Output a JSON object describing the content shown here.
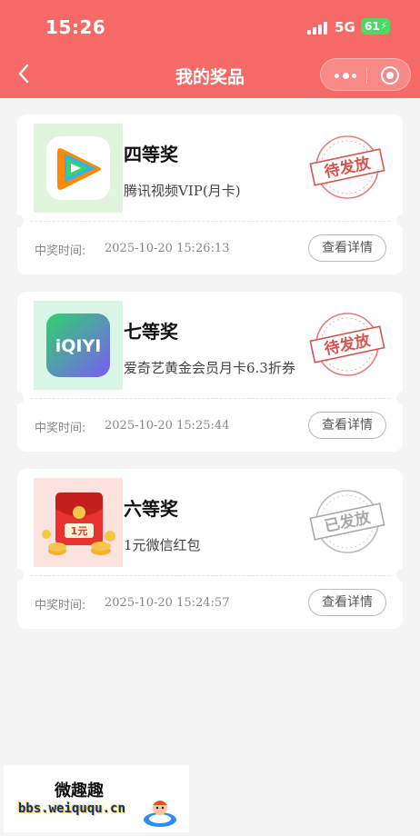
{
  "status_bar": {
    "time": "15:26",
    "network": "5G",
    "battery": "61"
  },
  "nav": {
    "title": "我的奖品"
  },
  "colors": {
    "brand": "#f56a66",
    "pending_stamp": "#d9534f",
    "issued_stamp": "#a9a9a9"
  },
  "prizes": [
    {
      "tier": "四等奖",
      "description": "腾讯视频VIP(月卡)",
      "stamp": "待发放",
      "win_label": "中奖时间:",
      "win_time": "2025-10-20 15:26:13",
      "detail_label": "查看详情",
      "icon": "tencent-video-icon"
    },
    {
      "tier": "七等奖",
      "description": "爱奇艺黄金会员月卡6.3折券",
      "stamp": "待发放",
      "win_label": "中奖时间:",
      "win_time": "2025-10-20 15:25:44",
      "detail_label": "查看详情",
      "icon": "iqiyi-icon",
      "icon_text": "iQIYI"
    },
    {
      "tier": "六等奖",
      "description": "1元微信红包",
      "stamp": "已发放",
      "win_label": "中奖时间:",
      "win_time": "2025-10-20 15:24:57",
      "detail_label": "查看详情",
      "icon": "red-packet-icon",
      "icon_text": "1元"
    }
  ],
  "watermark": {
    "title": "微趣趣",
    "url": "bbs.weiququ.cn"
  }
}
